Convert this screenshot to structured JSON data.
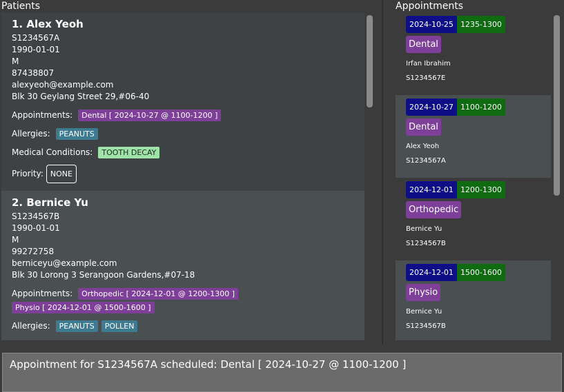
{
  "sections": {
    "patients_title": "Patients",
    "appointments_title": "Appointments"
  },
  "patients": [
    {
      "index_name": "1. Alex Yeoh",
      "nric": "S1234567A",
      "dob": "1990-01-01",
      "sex": "M",
      "phone": "87438807",
      "email": "alexyeoh@example.com",
      "address": "Blk 30 Geylang Street 29,#06-40",
      "appointments_label": "Appointments:",
      "appointments": [
        "Dental [ 2024-10-27 @ 1100-1200 ]"
      ],
      "allergies_label": "Allergies:",
      "allergies": [
        "PEANUTS"
      ],
      "conditions_label": "Medical Conditions:",
      "conditions": [
        "TOOTH DECAY"
      ],
      "priority_label": "Priority:",
      "priority": "NONE"
    },
    {
      "index_name": "2. Bernice Yu",
      "nric": "S1234567B",
      "dob": "1990-01-01",
      "sex": "M",
      "phone": "99272758",
      "email": "berniceyu@example.com",
      "address": "Blk 30 Lorong 3 Serangoon Gardens,#07-18",
      "appointments_label": "Appointments:",
      "appointments": [
        "Orthopedic [ 2024-12-01 @ 1200-1300 ]",
        "Physio [ 2024-12-01 @ 1500-1600 ]"
      ],
      "allergies_label": "Allergies:",
      "allergies": [
        "PEANUTS",
        "POLLEN"
      ]
    }
  ],
  "appointments": [
    {
      "date": "2024-10-25",
      "time": "1235-1300",
      "type": "Dental",
      "name": "Irfan Ibrahim",
      "nric": "S1234567E"
    },
    {
      "date": "2024-10-27",
      "time": "1100-1200",
      "type": "Dental",
      "name": "Alex Yeoh",
      "nric": "S1234567A"
    },
    {
      "date": "2024-12-01",
      "time": "1200-1300",
      "type": "Orthopedic",
      "name": "Bernice Yu",
      "nric": "S1234567B"
    },
    {
      "date": "2024-12-01",
      "time": "1500-1600",
      "type": "Physio",
      "name": "Bernice Yu",
      "nric": "S1234567B"
    }
  ],
  "result": {
    "message": "Appointment for S1234567A scheduled: Dental [ 2024-10-27 @ 1100-1200 ]"
  }
}
